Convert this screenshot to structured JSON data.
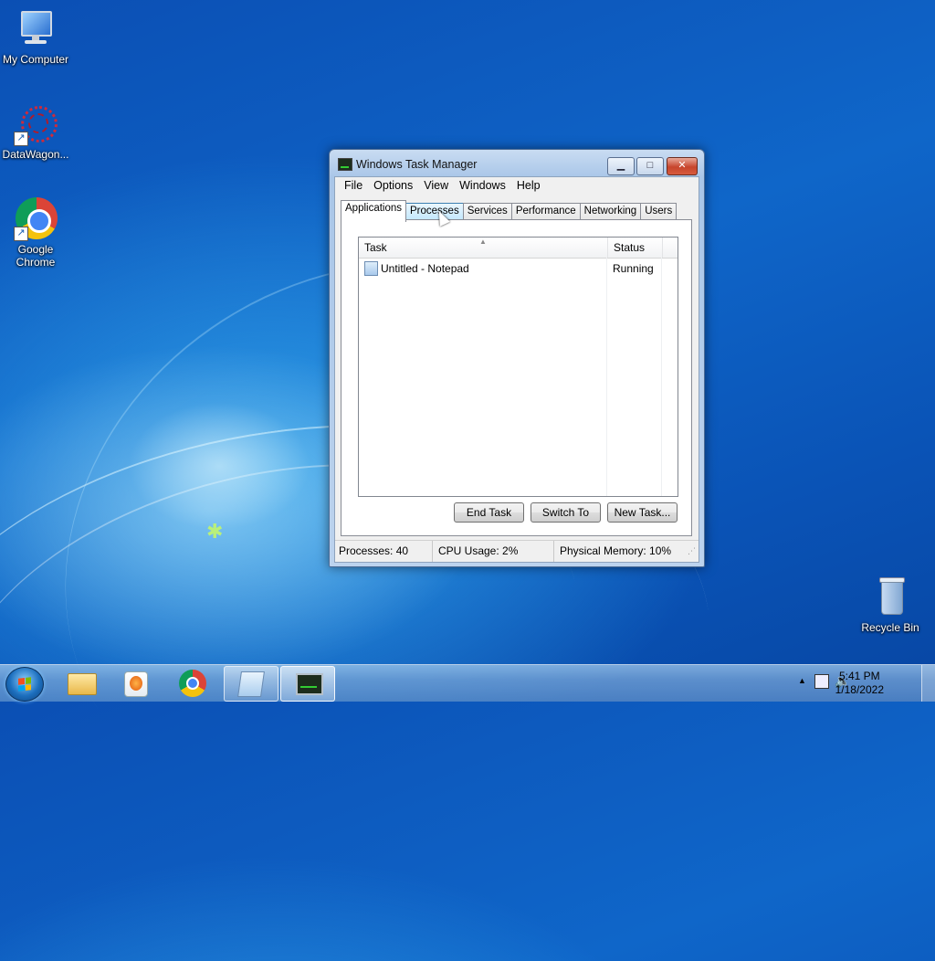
{
  "desktop": {
    "icons": [
      {
        "label": "My Computer"
      },
      {
        "label": "DataWagon..."
      },
      {
        "label": "Google Chrome"
      },
      {
        "label": "Recycle Bin"
      }
    ]
  },
  "window": {
    "title": "Windows Task Manager",
    "menu": [
      "File",
      "Options",
      "View",
      "Windows",
      "Help"
    ],
    "tabs": [
      "Applications",
      "Processes",
      "Services",
      "Performance",
      "Networking",
      "Users"
    ],
    "active_tab": "Applications",
    "hover_tab": "Processes",
    "columns": {
      "task": "Task",
      "status": "Status"
    },
    "rows": [
      {
        "task": "Untitled - Notepad",
        "status": "Running"
      }
    ],
    "buttons": {
      "end_task": "End Task",
      "switch_to": "Switch To",
      "new_task": "New Task..."
    },
    "status": {
      "processes": "Processes: 40",
      "cpu": "CPU Usage: 2%",
      "memory": "Physical Memory: 10%"
    }
  },
  "taskbar": {
    "pinned": [
      "windows-explorer-icon",
      "media-player-icon",
      "chrome-icon",
      "notepad-icon",
      "task-manager-icon"
    ],
    "clock": {
      "time": "5:41 PM",
      "date": "1/18/2022"
    }
  },
  "colors": {
    "accent": "#1c6fbe",
    "close": "#c7452c"
  }
}
